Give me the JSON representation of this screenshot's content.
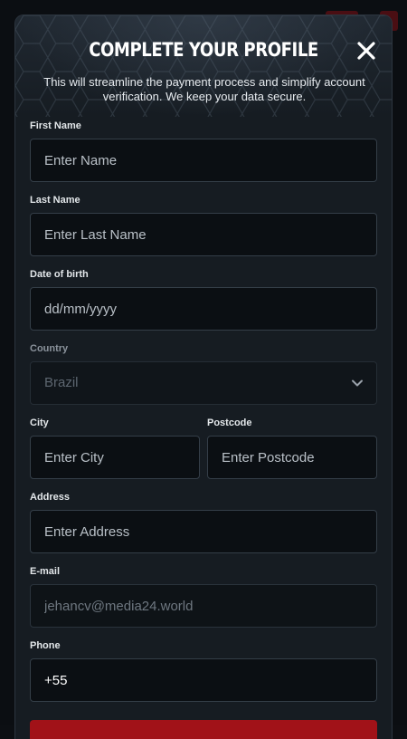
{
  "modal": {
    "title": "COMPLETE YOUR PROFILE",
    "subtitle": "This will streamline the payment process and simplify account verification. We keep your data secure.",
    "close_icon": "close-icon"
  },
  "form": {
    "first_name": {
      "label": "First Name",
      "placeholder": "Enter Name"
    },
    "last_name": {
      "label": "Last Name",
      "placeholder": "Enter Last Name"
    },
    "dob": {
      "label": "Date of birth",
      "placeholder": "dd/mm/yyyy"
    },
    "country": {
      "label": "Country",
      "value": "Brazil"
    },
    "city": {
      "label": "City",
      "placeholder": "Enter City"
    },
    "postcode": {
      "label": "Postcode",
      "placeholder": "Enter Postcode"
    },
    "address": {
      "label": "Address",
      "placeholder": "Enter Address"
    },
    "email": {
      "label": "E-mail",
      "value": "jehancv@media24.world"
    },
    "phone": {
      "label": "Phone",
      "value": "+55"
    }
  },
  "colors": {
    "accent": "#a11218",
    "modal_bg": "#161c22",
    "input_bg": "#0b0f13",
    "input_border": "#343e48"
  }
}
